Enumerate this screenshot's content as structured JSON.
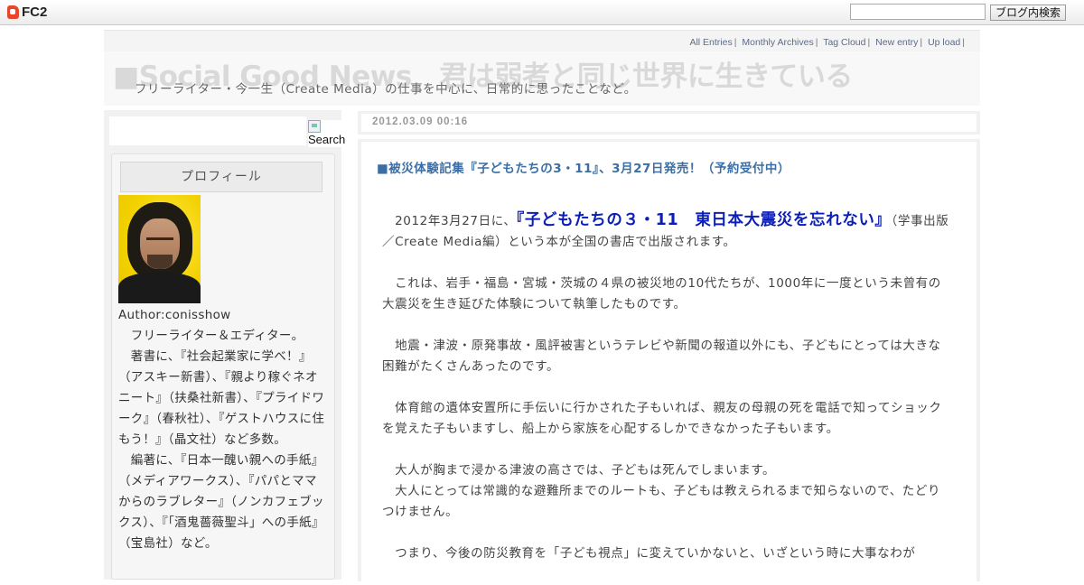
{
  "fc2": {
    "logo_text": "FC2",
    "search_placeholder": "",
    "search_button": "ブログ内検索"
  },
  "nav": {
    "links": [
      "All Entries",
      "Monthly Archives",
      "Tag Cloud",
      "New entry",
      "Up load"
    ],
    "separator": "|"
  },
  "header": {
    "title": "■Social Good News　君は弱者と同じ世界に生きている",
    "description": "フリーライター・今一生（Create Media）の仕事を中心に、日常的に思ったことなど。"
  },
  "sidebar": {
    "search_image_alt": "Search",
    "profile_title": "プロフィール",
    "author": "Author:conisshow",
    "bio": [
      "　フリーライター＆エディター。",
      "　著書に、『社会起業家に学べ！』（アスキー新書）、『親より稼ぐネオニート』（扶桑社新書）、『プライドワーク』（春秋社）、『ゲストハウスに住もう！』（晶文社）など多数。",
      "　編著に、『日本一醜い親への手紙』（メディアワークス）、『パパとママからのラブレター』（ノンカフェブックス）、『「酒鬼薔薇聖斗」への手紙』（宝島社）など。"
    ]
  },
  "entry": {
    "date": "2012.03.09 00:16",
    "title": "■被災体験記集『子どもたちの3・11』、3月27日発売！（予約受付中）",
    "intro_prefix": "　2012年3月27日に、",
    "book_title": "『子どもたちの３・11　東日本大震災を忘れない』",
    "intro_suffix": "（学事出版／Create Media編）という本が全国の書店で出版されます。",
    "paragraphs": [
      "　これは、岩手・福島・宮城・茨城の４県の被災地の10代たちが、1000年に一度という未曾有の大震災を生き延びた体験について執筆したものです。",
      "　地震・津波・原発事故・風評被害というテレビや新聞の報道以外にも、子どもにとっては大きな困難がたくさんあったのです。",
      "　体育館の遺体安置所に手伝いに行かされた子もいれば、親友の母親の死を電話で知ってショックを覚えた子もいますし、船上から家族を心配するしかできなかった子もいます。"
    ],
    "para_pair": [
      "　大人が胸まで浸かる津波の高さでは、子どもは死んでしまいます。",
      "　大人にとっては常識的な避難所までのルートも、子どもは教えられるまで知らないので、たどりつけません。"
    ],
    "last_paragraph": "　つまり、今後の防災教育を「子ども視点」に変えていかないと、いざという時に大事なわが"
  }
}
